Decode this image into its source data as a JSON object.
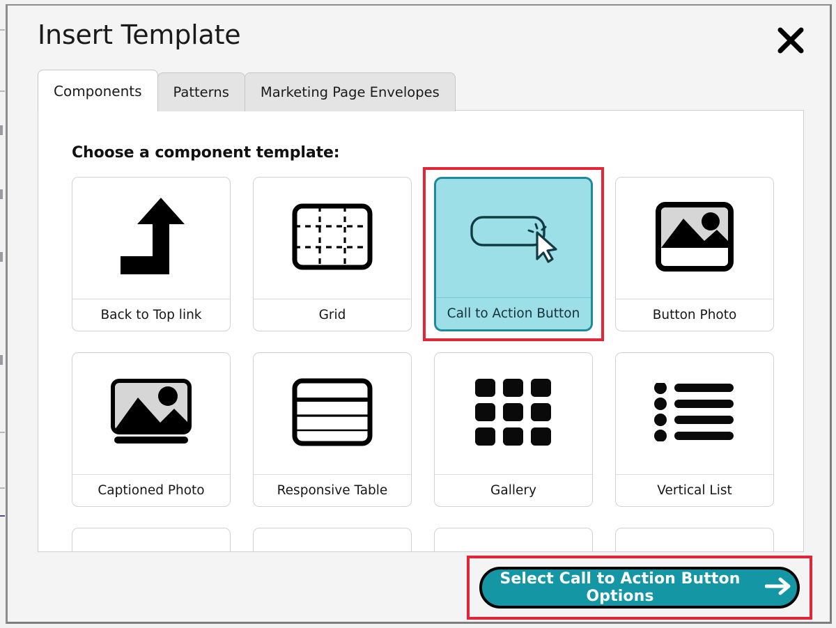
{
  "window": {
    "title": "Insert Template",
    "close_label": "✕",
    "close_icon": "close-icon"
  },
  "tabs": [
    {
      "label": "Components",
      "active": true
    },
    {
      "label": "Patterns",
      "active": false
    },
    {
      "label": "Marketing Page Envelopes",
      "active": false
    }
  ],
  "content": {
    "heading": "Choose a component template:",
    "cards": [
      {
        "label": "Back to Top link",
        "icon": "back-to-top-arrow-icon",
        "selected": false
      },
      {
        "label": "Grid",
        "icon": "grid-icon",
        "selected": false
      },
      {
        "label": "Call to Action Button",
        "icon": "call-to-action-cursor-icon",
        "selected": true
      },
      {
        "label": "Button Photo",
        "icon": "button-photo-icon",
        "selected": false
      },
      {
        "label": "Captioned Photo",
        "icon": "captioned-photo-icon",
        "selected": false
      },
      {
        "label": "Responsive Table",
        "icon": "responsive-table-icon",
        "selected": false
      },
      {
        "label": "Gallery",
        "icon": "gallery-grid-icon",
        "selected": false
      },
      {
        "label": "Vertical List",
        "icon": "vertical-list-icon",
        "selected": false
      }
    ]
  },
  "footer": {
    "cta_label": "Select Call to Action Button Options",
    "cta_icon": "arrow-right-icon"
  },
  "colors": {
    "accent_teal": "#1496a5",
    "selected_card_fill": "#9ddfe6",
    "selected_card_border": "#1d8b9c",
    "highlight_red": "#e32636",
    "modal_background": "#f4f4f4",
    "panel_background": "#ffffff"
  }
}
